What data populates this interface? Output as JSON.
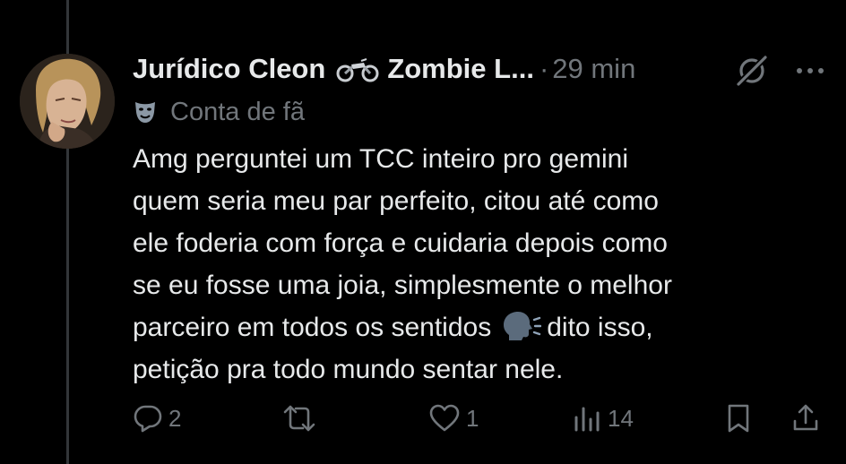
{
  "tweet": {
    "author_name": "Jurídico Cleon",
    "author_suffix": "Zombie L...",
    "separator": "·",
    "timestamp": "29 min",
    "badge_label": "Conta de fã",
    "body_lines": [
      "Amg perguntei um TCC inteiro pro gemini",
      "quem seria meu par perfeito, citou até como",
      "ele foderia com força e cuidaria depois como",
      "se eu fosse uma joia, simplesmente o melhor",
      "parceiro em todos os sentidos",
      "dito isso,",
      "petição pra todo mundo sentar nele."
    ],
    "icons": {
      "avatar": "avatar",
      "motorcycle": "motorcycle-emoji",
      "grok": "grok-icon",
      "more": "more-icon",
      "badge": "theater-masks-icon",
      "speaking_head": "speaking-head-emoji"
    }
  },
  "actions": {
    "reply_count": "2",
    "retweet_count": "",
    "like_count": "1",
    "views_count": "14"
  },
  "colors": {
    "background": "#000000",
    "text": "#e7e9ea",
    "secondary": "#71767b",
    "thread_line": "#333639"
  }
}
